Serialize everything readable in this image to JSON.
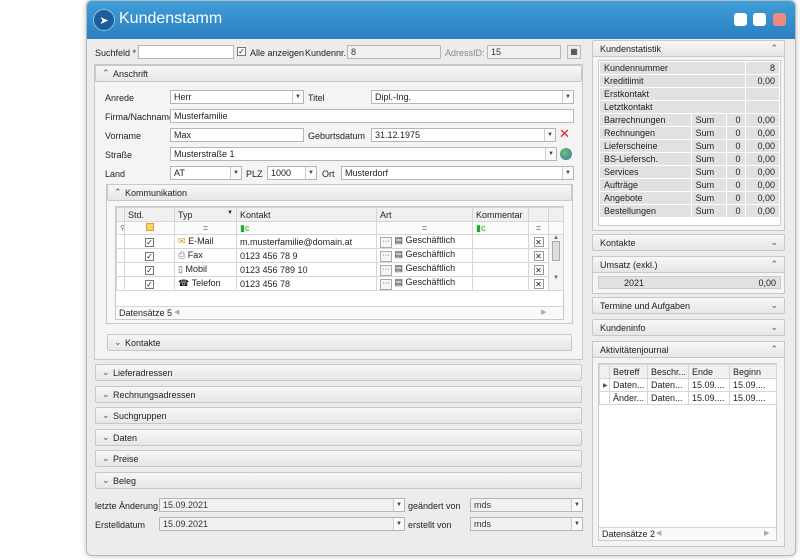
{
  "window": {
    "title": "Kundenstamm"
  },
  "top": {
    "search_label": "Suchfeld *",
    "search_value": "",
    "show_all": "Alle anzeigen",
    "kundennr_label": "Kundennr.",
    "kundennr": "8",
    "adressid_label": "AdressID:",
    "adressid": "15"
  },
  "anschrift": {
    "title": "Anschrift",
    "anrede_label": "Anrede",
    "anrede": "Herr",
    "titel_label": "Titel",
    "titel": "Dipl.-Ing.",
    "firma_label": "Firma/Nachname",
    "firma": "Musterfamilie",
    "vorname_label": "Vorname",
    "vorname": "Max",
    "geburt_label": "Geburtsdatum",
    "geburt": "31.12.1975",
    "strasse_label": "Straße",
    "strasse": "Musterstraße 1",
    "land_label": "Land",
    "land": "AT",
    "plz_label": "PLZ",
    "plz": "1000",
    "ort_label": "Ort",
    "ort": "Musterdorf"
  },
  "kommunikation": {
    "title": "Kommunikation",
    "headers": [
      "Std.",
      "Typ",
      "Kontakt",
      "Art",
      "Kommentar"
    ],
    "rows": [
      {
        "typ": "E-Mail",
        "kontakt": "m.musterfamilie@domain.at",
        "art": "Geschäftlich",
        "icon": "email-icon"
      },
      {
        "typ": "Fax",
        "kontakt": "0123 456 78 9",
        "art": "Geschäftlich",
        "icon": "fax-icon"
      },
      {
        "typ": "Mobil",
        "kontakt": "0123 456 789 10",
        "art": "Geschäftlich",
        "icon": "mobile-icon"
      },
      {
        "typ": "Telefon",
        "kontakt": "0123 456 78",
        "art": "Geschäftlich",
        "icon": "phone-icon"
      }
    ],
    "footer": "Datensätze 5",
    "kontakte": "Kontakte"
  },
  "sections": [
    "Lieferadressen",
    "Rechnungsadressen",
    "Suchgruppen",
    "Daten",
    "Preise",
    "Beleg"
  ],
  "bottom": {
    "letzte_label": "letzte Änderung",
    "letzte": "15.09.2021",
    "geaendert_label": "geändert von",
    "geaendert": "mds",
    "erstell_label": "Erstelldatum",
    "erstell": "15.09.2021",
    "erstellt_label": "erstellt von",
    "erstellt": "mds"
  },
  "stat": {
    "title": "Kundenstatistik",
    "simple": [
      [
        "Kundennummer",
        "8"
      ],
      [
        "Kreditlimit",
        "0,00"
      ],
      [
        "Erstkontakt",
        ""
      ],
      [
        "Letztkontakt",
        ""
      ]
    ],
    "rows": [
      [
        "Barrechnungen",
        "Sum",
        "0",
        "0,00"
      ],
      [
        "Rechnungen",
        "Sum",
        "0",
        "0,00"
      ],
      [
        "Lieferscheine",
        "Sum",
        "0",
        "0,00"
      ],
      [
        "BS-Liefersch.",
        "Sum",
        "0",
        "0,00"
      ],
      [
        "Services",
        "Sum",
        "0",
        "0,00"
      ],
      [
        "Aufträge",
        "Sum",
        "0",
        "0,00"
      ],
      [
        "Angebote",
        "Sum",
        "0",
        "0,00"
      ],
      [
        "Bestellungen",
        "Sum",
        "0",
        "0,00"
      ]
    ]
  },
  "right": {
    "kontakte": "Kontakte",
    "umsatz": "Umsatz (exkl.)",
    "umsatz_year": "2021",
    "umsatz_val": "0,00",
    "termine": "Termine und Aufgaben",
    "kundeninfo": "Kundeninfo",
    "journal": "Aktivitätenjournal"
  },
  "journal": {
    "headers": [
      "Betreff",
      "Beschr...",
      "Ende",
      "Beginn"
    ],
    "rows": [
      [
        "Daten...",
        "Daten...",
        "15.09....",
        "15.09...."
      ],
      [
        "Änder...",
        "Daten...",
        "15.09....",
        "15.09...."
      ]
    ],
    "footer": "Datensätze 2"
  }
}
